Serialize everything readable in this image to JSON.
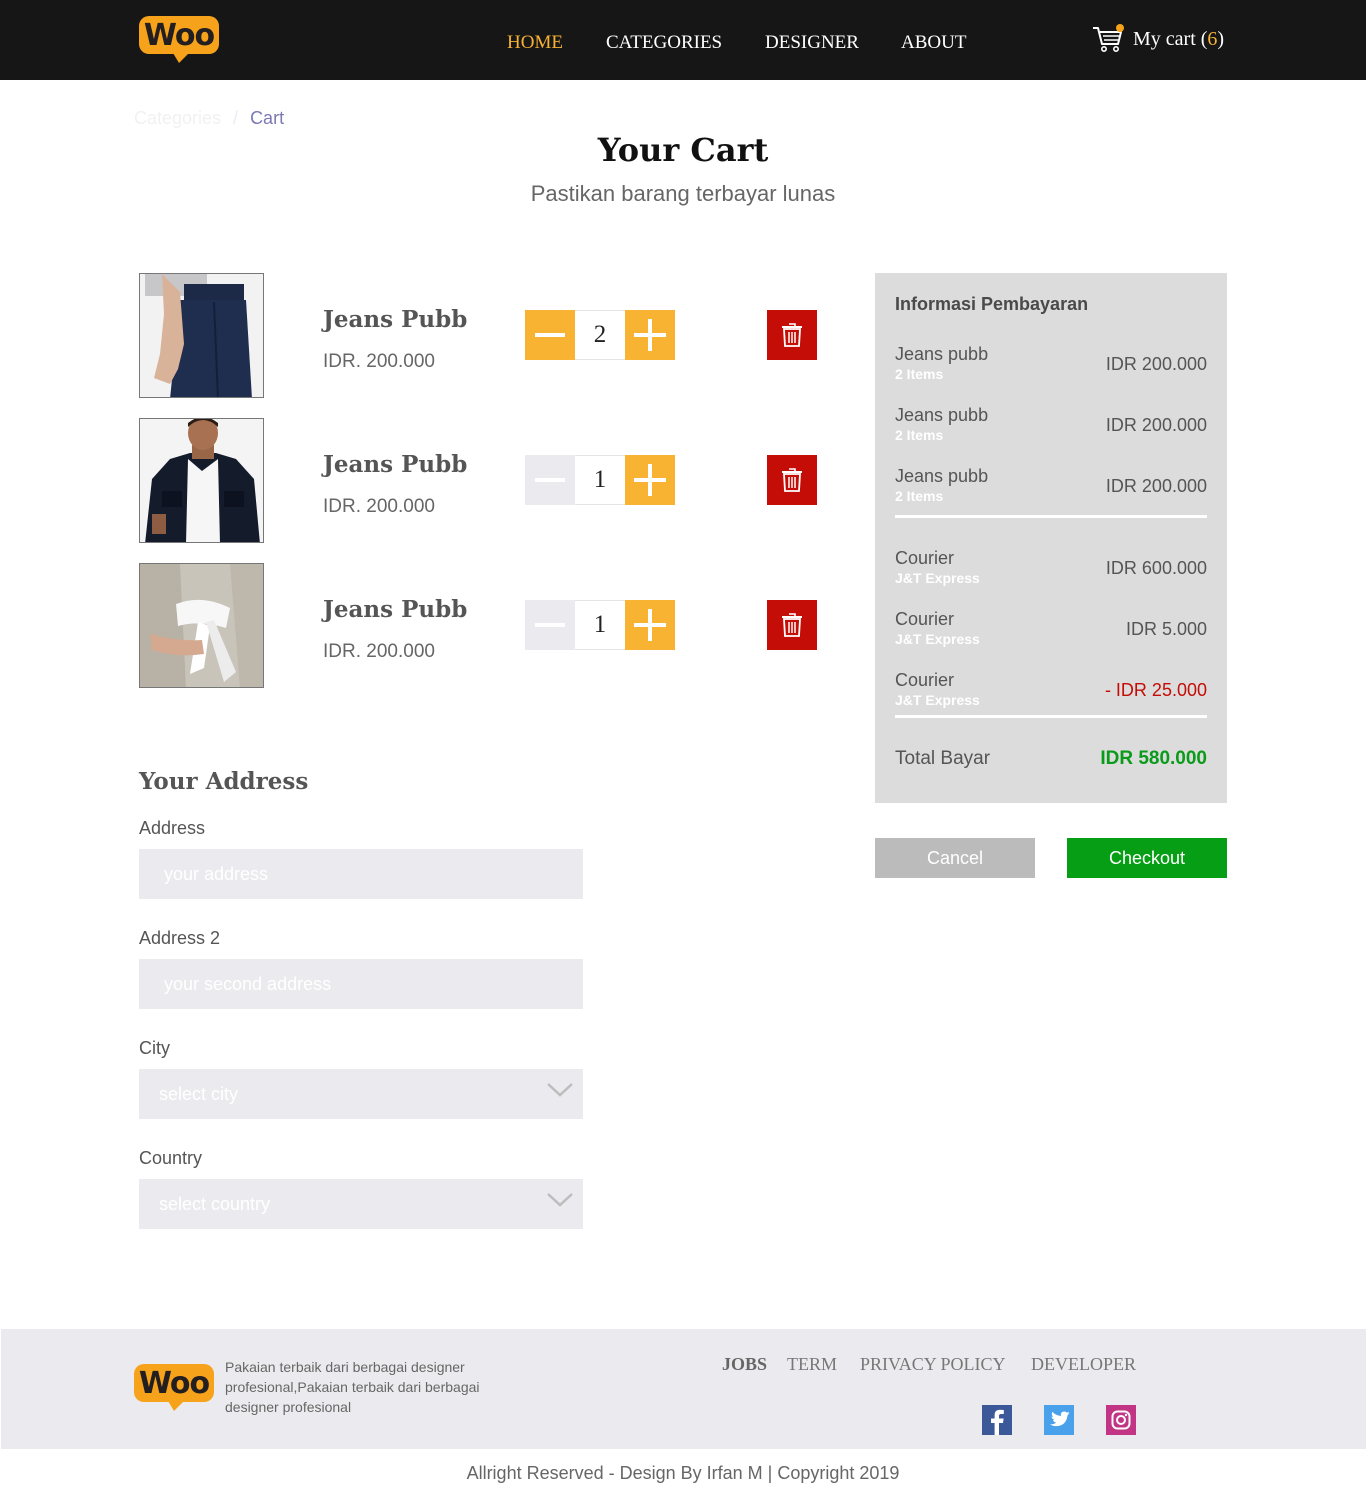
{
  "brand": {
    "logo_text": "Woo"
  },
  "nav": {
    "items": [
      {
        "label": "HOME",
        "active": true
      },
      {
        "label": "CATEGORIES",
        "active": false
      },
      {
        "label": "DESIGNER",
        "active": false
      },
      {
        "label": "ABOUT",
        "active": false
      }
    ],
    "cart_label": "My cart (",
    "cart_count": "6",
    "cart_close": ")"
  },
  "breadcrumb": {
    "parent": "Categories",
    "separator": "/",
    "current": "Cart"
  },
  "page": {
    "title": "Your Cart",
    "subtitle": "Pastikan barang terbayar lunas"
  },
  "cart_items": [
    {
      "name": "Jeans Pubb",
      "price": "IDR. 200.000",
      "qty": "2",
      "minus_enabled": true,
      "image": "dark-trousers-photo"
    },
    {
      "name": "Jeans Pubb",
      "price": "IDR. 200.000",
      "qty": "1",
      "minus_enabled": false,
      "image": "man-black-jacket-photo"
    },
    {
      "name": "Jeans Pubb",
      "price": "IDR. 200.000",
      "qty": "1",
      "minus_enabled": false,
      "image": "beige-coat-white-sash-photo"
    }
  ],
  "payment": {
    "title": "Informasi Pembayaran",
    "products": [
      {
        "label": "Jeans pubb",
        "sub": "2 Items",
        "value": "IDR 200.000"
      },
      {
        "label": "Jeans pubb",
        "sub": "2 Items",
        "value": "IDR 200.000"
      },
      {
        "label": "Jeans pubb",
        "sub": "2 Items",
        "value": "IDR 200.000"
      }
    ],
    "fees": [
      {
        "label": "Courier",
        "sub": "J&T Express",
        "value": "IDR 600.000",
        "negative": false
      },
      {
        "label": "Courier",
        "sub": "J&T Express",
        "value": "IDR 5.000",
        "negative": false
      },
      {
        "label": "Courier",
        "sub": "J&T Express",
        "value": "- IDR 25.000",
        "negative": true
      }
    ],
    "total_label": "Total Bayar",
    "total_value": "IDR 580.000",
    "cancel_label": "Cancel",
    "checkout_label": "Checkout"
  },
  "address": {
    "title": "Your Address",
    "fields": [
      {
        "label": "Address",
        "placeholder": "your address",
        "type": "input"
      },
      {
        "label": "Address 2",
        "placeholder": "your second address",
        "type": "input"
      },
      {
        "label": "City",
        "placeholder": "select city",
        "type": "select"
      },
      {
        "label": "Country",
        "placeholder": "select country",
        "type": "select"
      }
    ]
  },
  "footer": {
    "description": "Pakaian terbaik dari berbagai designer profesional,Pakaian terbaik dari berbagai designer profesional",
    "links": [
      "JOBS",
      "TERM",
      "PRIVACY POLICY",
      "DEVELOPER"
    ],
    "social": [
      "facebook-icon",
      "twitter-icon",
      "instagram-icon"
    ],
    "copyright": "Allright Reserved - Design By Irfan M | Copyright 2019"
  },
  "colors": {
    "header_bg": "#161616",
    "accent": "#f8b333",
    "delete": "#c40d06",
    "checkout": "#059e14",
    "total": "#0a9b1a",
    "panel_bg": "#dcdcdc",
    "input_bg": "#ebebef"
  }
}
